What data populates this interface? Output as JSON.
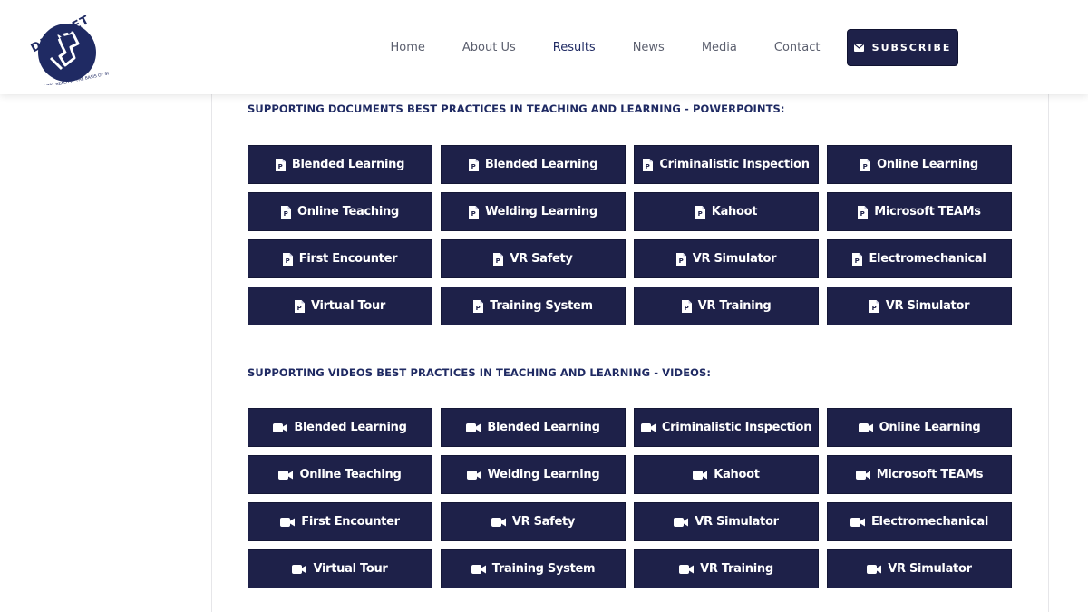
{
  "brand": {
    "logo_text": "DRINVET",
    "logo_tagline": "DIGITAL REALITY · THE BASIS OF SKILLS TRAINING",
    "primary_color": "#1e2149",
    "accent_color": "#1f2a63"
  },
  "nav": {
    "items": [
      {
        "label": "Home",
        "active": false
      },
      {
        "label": "About Us",
        "active": false
      },
      {
        "label": "Results",
        "active": true
      },
      {
        "label": "News",
        "active": false
      },
      {
        "label": "Media",
        "active": false
      },
      {
        "label": "Contact",
        "active": false
      }
    ],
    "subscribe_label": "SUBSCRIBE",
    "subscribe_icon": "envelope-icon"
  },
  "documents": {
    "title": "SUPPORTING DOCUMENTS BEST PRACTICES IN TEACHING AND LEARNING - POWERPOINTS:",
    "icon": "powerpoint-file-icon",
    "buttons": [
      "Blended Learning",
      "Blended Learning",
      "Criminalistic Inspection",
      "Online Learning",
      "Online Teaching",
      "Welding Learning",
      "Kahoot",
      "Microsoft TEAMs",
      "First Encounter",
      "VR Safety",
      "VR Simulator",
      "Electromechanical",
      "Virtual Tour",
      "Training System",
      "VR Training",
      "VR Simulator"
    ]
  },
  "videos": {
    "title": "SUPPORTING VIDEOS BEST PRACTICES IN TEACHING AND LEARNING - VIDEOS:",
    "icon": "video-camera-icon",
    "buttons": [
      "Blended Learning",
      "Blended Learning",
      "Criminalistic Inspection",
      "Online Learning",
      "Online Teaching",
      "Welding Learning",
      "Kahoot",
      "Microsoft TEAMs",
      "First Encounter",
      "VR Safety",
      "VR Simulator",
      "Electromechanical",
      "Virtual Tour",
      "Training System",
      "VR Training",
      "VR Simulator"
    ]
  }
}
